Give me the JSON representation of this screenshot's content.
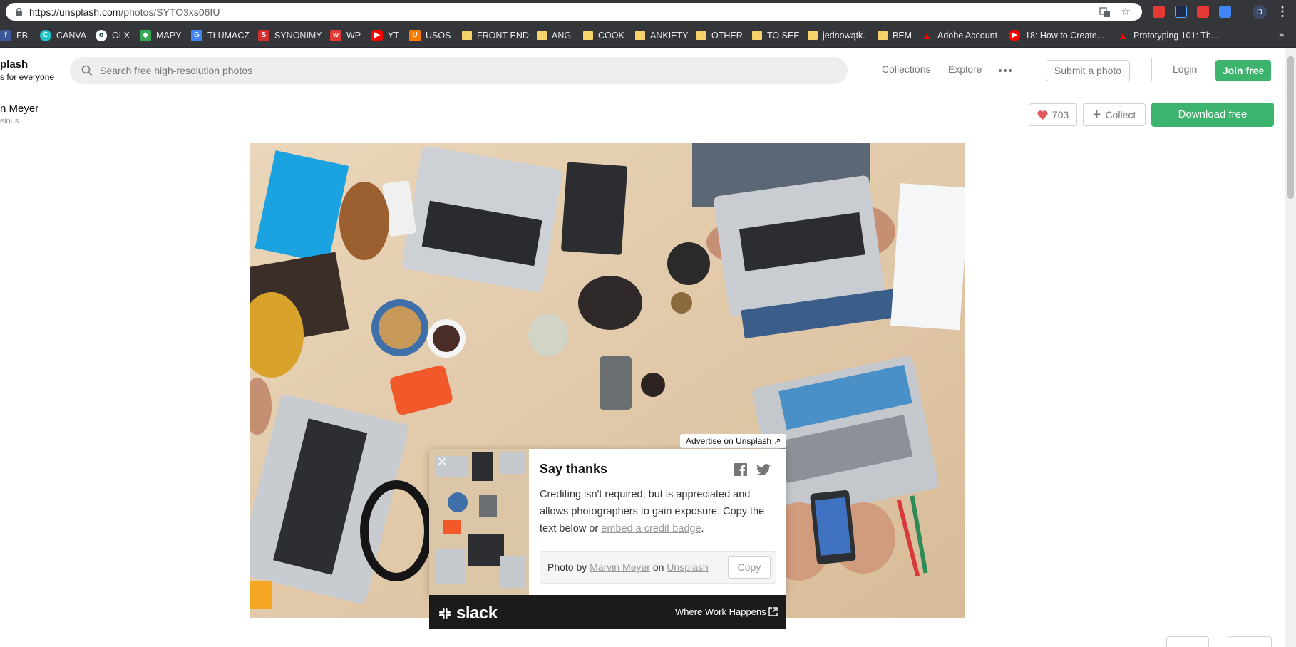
{
  "browser": {
    "url_host": "https://unsplash.com",
    "url_path": "/photos/SYTO3xs06fU",
    "profile_initial": "D",
    "bookmarks": [
      {
        "label": "FB",
        "icon": "facebook-icon",
        "color": "#3b5998"
      },
      {
        "label": "CANVA",
        "icon": "canva-icon",
        "color": "#20c4cb"
      },
      {
        "label": "OLX",
        "icon": "olx-icon",
        "color": "#ffffff"
      },
      {
        "label": "MAPY",
        "icon": "maps-icon",
        "color": "#34a853"
      },
      {
        "label": "TŁUMACZ",
        "icon": "translate-icon",
        "color": "#4285f4"
      },
      {
        "label": "SYNONIMY",
        "icon": "synonimy-icon",
        "color": "#d32f2f"
      },
      {
        "label": "WP",
        "icon": "wp-icon",
        "color": "#e53935"
      },
      {
        "label": "YT",
        "icon": "youtube-icon",
        "color": "#ff0000"
      },
      {
        "label": "USOS",
        "icon": "usos-icon",
        "color": "#f57c00"
      },
      {
        "label": "FRONT-END",
        "icon": "folder-icon"
      },
      {
        "label": "ANG",
        "icon": "folder-icon"
      },
      {
        "label": "COOK",
        "icon": "folder-icon"
      },
      {
        "label": "ANKIETY",
        "icon": "folder-icon"
      },
      {
        "label": "OTHER",
        "icon": "folder-icon"
      },
      {
        "label": "TO SEE",
        "icon": "folder-icon"
      },
      {
        "label": "jednowątk.",
        "icon": "folder-icon"
      },
      {
        "label": "BEM",
        "icon": "folder-icon"
      },
      {
        "label": "Adobe Account",
        "icon": "adobe-icon",
        "color": "#ff0000"
      },
      {
        "label": "18: How to Create...",
        "icon": "youtube-icon",
        "color": "#ff0000"
      },
      {
        "label": "Prototyping 101: Th...",
        "icon": "adobe-icon",
        "color": "#ff0000"
      }
    ],
    "more_bookmarks": "»"
  },
  "header": {
    "brand_title": "plash",
    "brand_subtitle": "s for everyone",
    "search_placeholder": "Search free high-resolution photos",
    "nav": [
      "Collections",
      "Explore"
    ],
    "submit_label": "Submit a photo",
    "login_label": "Login",
    "join_label": "Join free"
  },
  "photo": {
    "author_name": "n Meyer",
    "author_handle": "elous",
    "likes": "703",
    "collect_label": "Collect",
    "download_label": "Download free"
  },
  "ad": {
    "advertise_label": "Advertise on Unsplash ↗",
    "slack_brand": "slack",
    "slack_tagline": "Where Work Happens"
  },
  "thanks": {
    "close": "×",
    "title": "Say thanks",
    "body_prefix": "Crediting isn't required, but is appreciated and allows photographers to gain exposure. Copy the text below or ",
    "body_link": "embed a credit badge",
    "body_suffix": ".",
    "credit_prefix": "Photo by ",
    "credit_author": "Marvin Meyer",
    "credit_mid": " on ",
    "credit_site": "Unsplash",
    "copy_label": "Copy"
  },
  "colors": {
    "accent_green": "#3cb46e",
    "chrome_dark": "#35363a",
    "heart_red": "#e25c5c"
  }
}
